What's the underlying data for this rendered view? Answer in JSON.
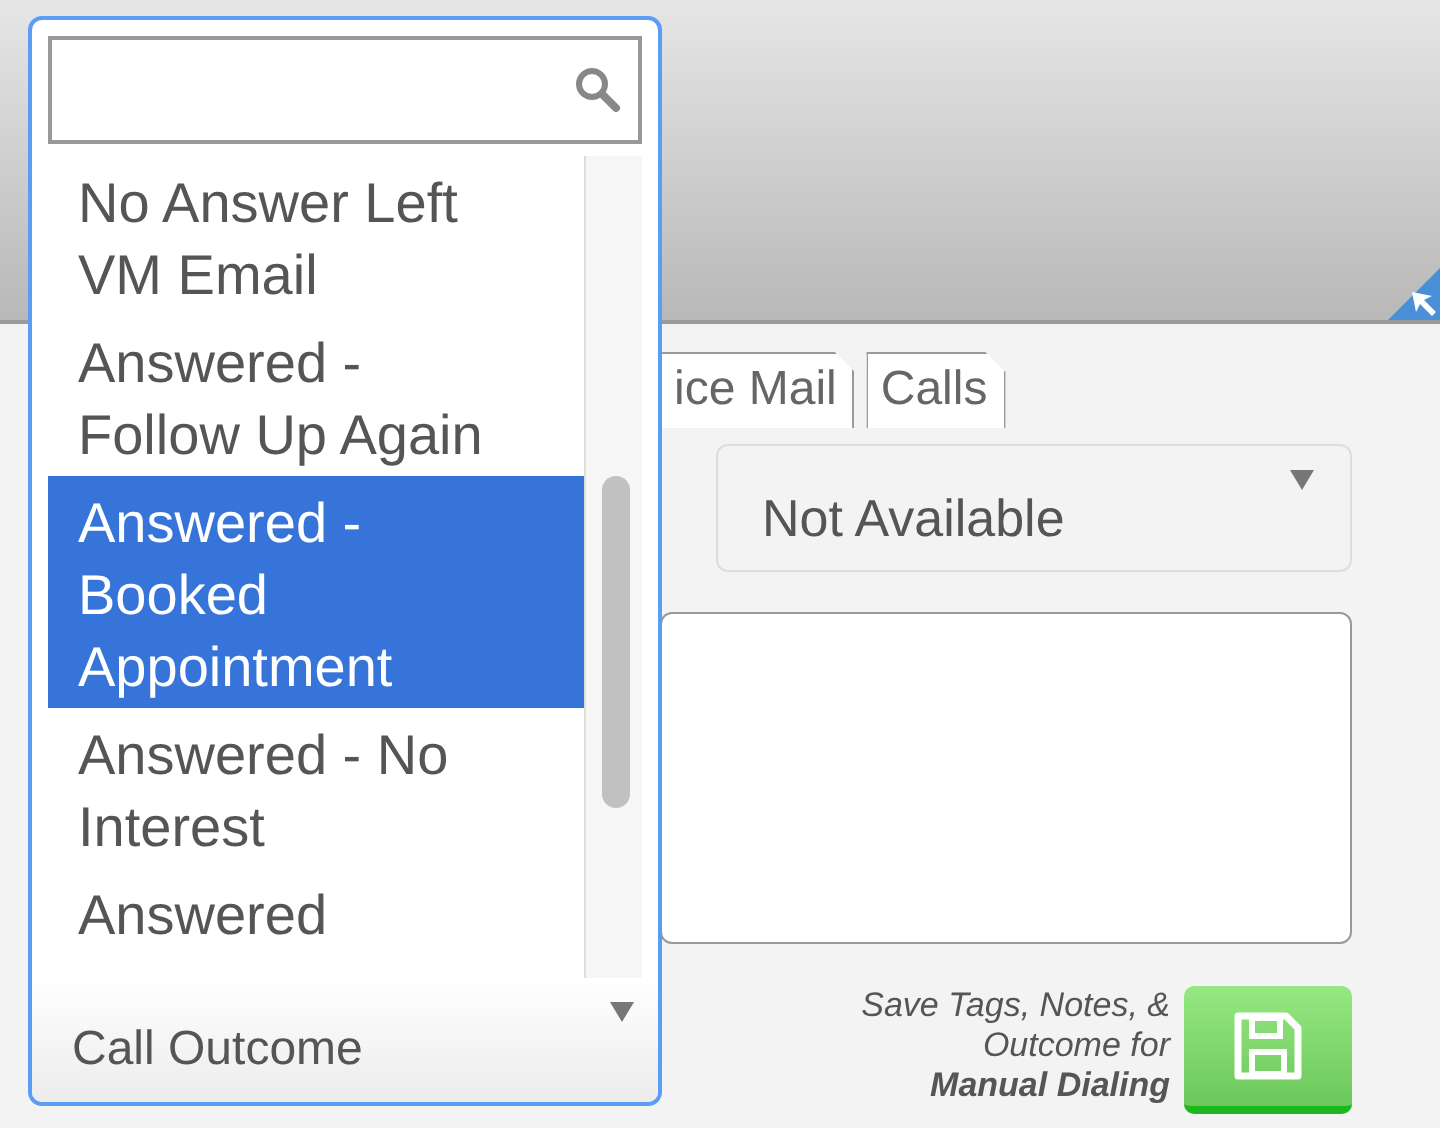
{
  "tabs": [
    {
      "label": "ice Mail",
      "selected": false
    },
    {
      "label": "Calls",
      "selected": false
    }
  ],
  "availability_select": {
    "value": "Not Available"
  },
  "notes": {
    "kind": "textarea"
  },
  "save": {
    "caption_lines": [
      "Save Tags, Notes, &",
      "Outcome for"
    ],
    "caption_bold": "Manual Dialing"
  },
  "dropdown": {
    "search": {
      "kind": "search"
    },
    "options": [
      {
        "label": "No Answer Left VM Email",
        "selected": false
      },
      {
        "label": "Answered - Follow Up Again",
        "selected": false
      },
      {
        "label": "Answered - Booked Appointment",
        "selected": true
      },
      {
        "label": "Answered - No Interest",
        "selected": false
      },
      {
        "label": "Answered",
        "selected": false
      }
    ],
    "value": "Call Outcome"
  }
}
